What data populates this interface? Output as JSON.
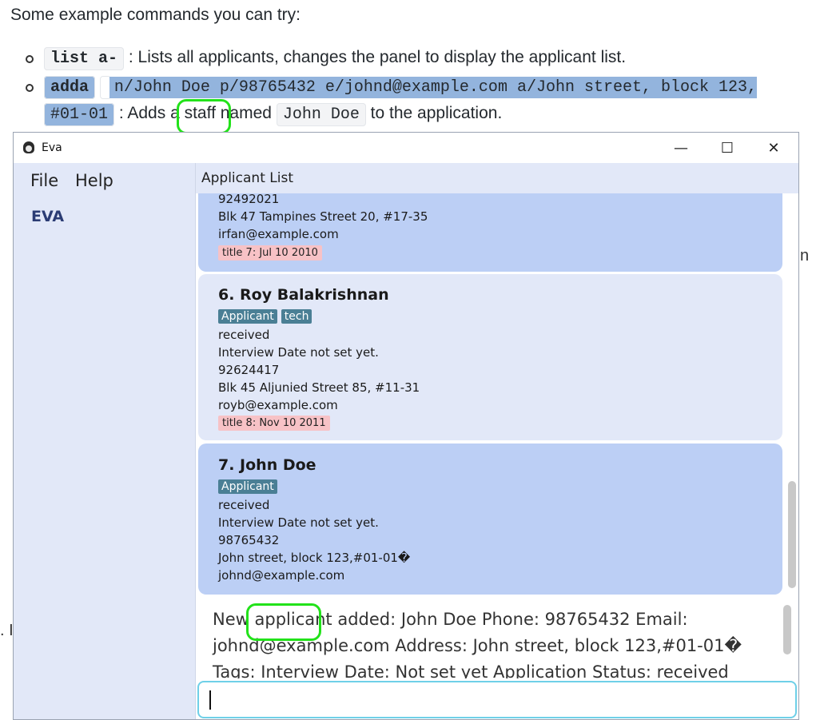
{
  "doc": {
    "intro": "Some example commands you can try:",
    "cmd1_code": "list a-",
    "cmd1_desc": ": Lists all applicants, changes the panel to display the applicant list.",
    "cmd2_word": "adda",
    "cmd2_args": "n/John Doe p/98765432 e/johnd@example.com a/John street, block 123,",
    "cmd2_args2": "#01-01",
    "cmd2_desc_a": ": Adds a",
    "cmd2_desc_staff": "staff",
    "cmd2_desc_b": "named",
    "cmd2_name_code": "John Doe",
    "cmd2_desc_c": "to the application.",
    "edge_right": "n",
    "edge_left": ". I"
  },
  "window": {
    "title": "Eva",
    "minimize": "—",
    "maximize": "☐",
    "close": "✕"
  },
  "menu": {
    "file": "File",
    "help": "Help"
  },
  "sidebar": {
    "brand": "EVA"
  },
  "panel": {
    "header": "Applicant List"
  },
  "cards": [
    {
      "phone": "92492021",
      "address": "Blk 47 Tampines Street 20, #17-35",
      "email": "irfan@example.com",
      "date_tag": "title 7: Jul 10 2010"
    },
    {
      "name": "6.  Roy Balakrishnan",
      "tags": [
        "Applicant",
        "tech"
      ],
      "status": "received",
      "interview": "Interview Date not set yet.",
      "phone": "92624417",
      "address": "Blk 45 Aljunied Street 85, #11-31",
      "email": "royb@example.com",
      "date_tag": "title 8: Nov 10 2011"
    },
    {
      "name": "7.  John Doe",
      "tags": [
        "Applicant"
      ],
      "status": "received",
      "interview": "Interview Date not set yet.",
      "phone": "98765432",
      "address": "John street, block 123,#01-01�",
      "email": "johnd@example.com"
    }
  ],
  "result": {
    "new": "New",
    "applicant": "applicant",
    "rest": "added: John Doe Phone: 98765432 Email: johnd@example.com Address: John street, block 123,#01-01� Tags: Interview Date: Not set yet Application Status: received"
  },
  "command_box": {
    "value": ""
  },
  "colors": {
    "sidebar_bg": "#e2e8f8",
    "card_selected": "#bccff5",
    "card_default": "#e2e8f8",
    "tag_bg": "#4a7f95",
    "date_tag_bg": "#f7c2c6",
    "annotation": "#22e21a",
    "input_border": "#6fd0e8"
  }
}
